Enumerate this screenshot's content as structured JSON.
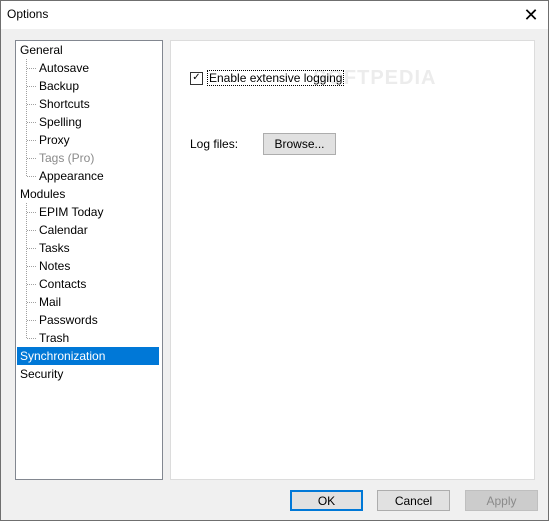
{
  "window": {
    "title": "Options",
    "close_glyph": "✕"
  },
  "tree": {
    "selected": "Synchronization",
    "items": [
      {
        "label": "General",
        "level": 0,
        "disabled": false
      },
      {
        "label": "Autosave",
        "level": 1,
        "disabled": false
      },
      {
        "label": "Backup",
        "level": 1,
        "disabled": false
      },
      {
        "label": "Shortcuts",
        "level": 1,
        "disabled": false
      },
      {
        "label": "Spelling",
        "level": 1,
        "disabled": false
      },
      {
        "label": "Proxy",
        "level": 1,
        "disabled": false
      },
      {
        "label": "Tags (Pro)",
        "level": 1,
        "disabled": true
      },
      {
        "label": "Appearance",
        "level": 1,
        "disabled": false
      },
      {
        "label": "Modules",
        "level": 0,
        "disabled": false
      },
      {
        "label": "EPIM Today",
        "level": 1,
        "disabled": false
      },
      {
        "label": "Calendar",
        "level": 1,
        "disabled": false
      },
      {
        "label": "Tasks",
        "level": 1,
        "disabled": false
      },
      {
        "label": "Notes",
        "level": 1,
        "disabled": false
      },
      {
        "label": "Contacts",
        "level": 1,
        "disabled": false
      },
      {
        "label": "Mail",
        "level": 1,
        "disabled": false
      },
      {
        "label": "Passwords",
        "level": 1,
        "disabled": false
      },
      {
        "label": "Trash",
        "level": 1,
        "disabled": false
      },
      {
        "label": "Synchronization",
        "level": 0,
        "disabled": false
      },
      {
        "label": "Security",
        "level": 0,
        "disabled": false
      }
    ]
  },
  "panel": {
    "checkbox_label": "Enable extensive logging",
    "checkbox_checked": true,
    "check_glyph": "✓",
    "watermark": "SOFTPEDIA",
    "log_files_label": "Log files:",
    "browse_label": "Browse..."
  },
  "buttons": {
    "ok": "OK",
    "cancel": "Cancel",
    "apply": "Apply"
  },
  "colors": {
    "selection": "#0078d7",
    "disabled_text": "#8a8a8a"
  }
}
